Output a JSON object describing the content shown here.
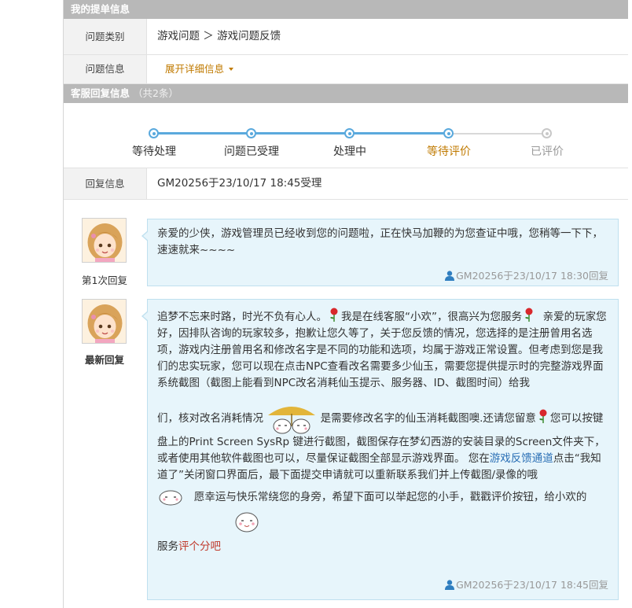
{
  "ticket": {
    "section_title": "我的提单信息",
    "category_label": "问题类别",
    "category_value": "游戏问题 ＞ 游戏问题反馈",
    "info_label": "问题信息",
    "expand_label": "展开详细信息"
  },
  "service": {
    "section_title": "客服回复信息",
    "count_text": "（共2条）",
    "steps": [
      "等待处理",
      "问题已受理",
      "处理中",
      "等待评价",
      "已评价"
    ],
    "current_step": 4,
    "reply_info_label": "回复信息",
    "reply_info_value": "GM20256于23/10/17 18:45受理"
  },
  "replies": [
    {
      "caption": "第1次回复",
      "text": "亲爱的少侠，游戏管理员已经收到您的问题啦，正在快马加鞭的为您查证中哦，您稍等一下下，速速就来~~~~",
      "signature": "GM20256于23/10/17 18:30回复"
    },
    {
      "caption": "最新回复",
      "p1a": "追梦不忘来时路，时光不负有心人。",
      "p1b": "我是在线客服“小欢”，很高兴为您服务",
      "p1c": "亲爱的玩家您好，因排队咨询的玩家较多，抱歉让您久等了，关于您反馈的情况，您选择的是注册曾用名选项，游戏内注册曾用名和修改名字是不同的功能和选项，均属于游戏正常设置。但考虑到您是我们的忠实玩家，您可以现在点击NPC查看改名需要多少仙玉，需要您提供提示时的完整游戏界面系统截图（截图上能看到NPC改名消耗仙玉提示、服务器、ID、截图时间）给我",
      "p2a": "们，核对改名消耗情况",
      "p2b": "是需要修改名字的仙玉消耗截图噢.还请您留意",
      "p2c": "您可以按键盘上的Print Screen SysRp 键进行截图，截图保存在梦幻西游的安装目录的Screen文件夹下，或者使用其他软件截图也可以，尽量保证截图全部显示游戏界面。 您在",
      "link_channel": "游戏反馈通道",
      "p2d": "点击“我知道了”关闭窗口界面后，最下面提交申请就可以重新联系我们并上传截图/录像的哦",
      "p3": "愿幸运与快乐常绕您的身旁，希望下面可以举起您的小手，戳戳评价按钮，给小欢的",
      "p4a": "服务",
      "link_rate": "评个分吧",
      "signature": "GM20256于23/10/17 18:45回复"
    }
  ],
  "colors": {
    "section_header_bg": "#b8b8b8",
    "progress_blue": "#5aa9dd",
    "current_step": "#c07a00",
    "bubble_bg": "#e7f5fb",
    "link_blue": "#2a6fb5",
    "link_red": "#c0392b"
  },
  "icons": [
    "rose-icon",
    "user-icon",
    "umbrella-emote-icon",
    "cute-face-emote-icon",
    "caret-down-icon"
  ]
}
